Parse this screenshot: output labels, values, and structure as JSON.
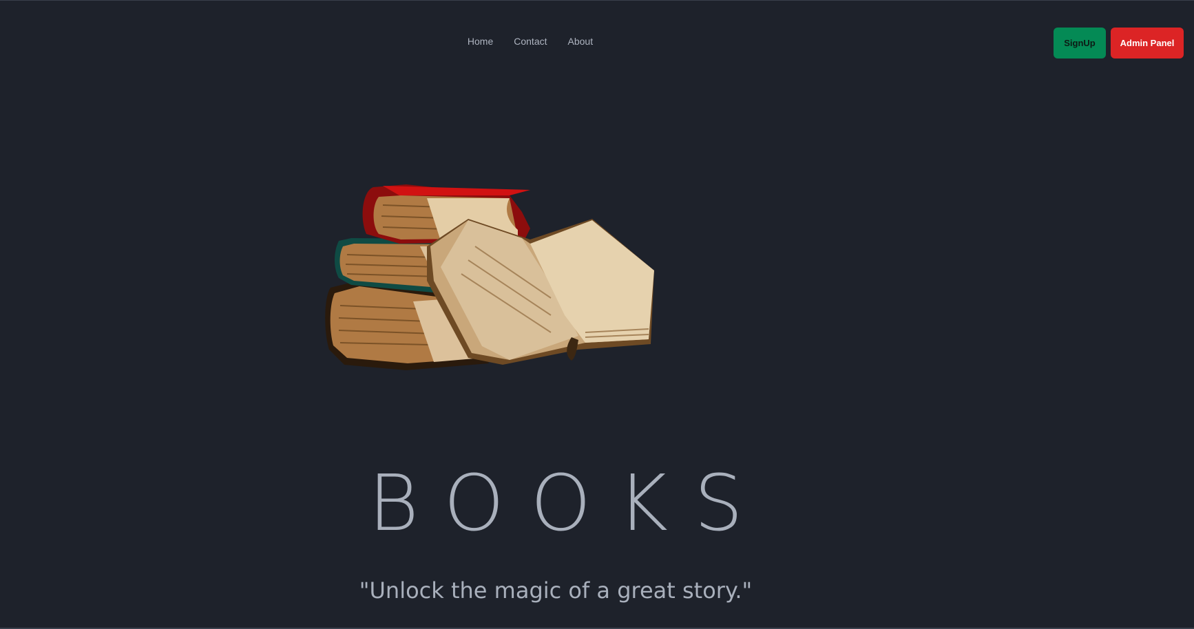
{
  "nav": {
    "items": [
      {
        "label": "Home"
      },
      {
        "label": "Contact"
      },
      {
        "label": "About"
      }
    ]
  },
  "actions": {
    "signup_label": "SignUp",
    "admin_label": "Admin Panel"
  },
  "hero": {
    "image_name": "books-illustration",
    "title": "BOOKS",
    "tagline": "\"Unlock the magic of a great story.\""
  },
  "colors": {
    "background": "#1e222b",
    "text_muted": "#a9b0bc",
    "signup": "#048a55",
    "admin": "#dc2425"
  }
}
